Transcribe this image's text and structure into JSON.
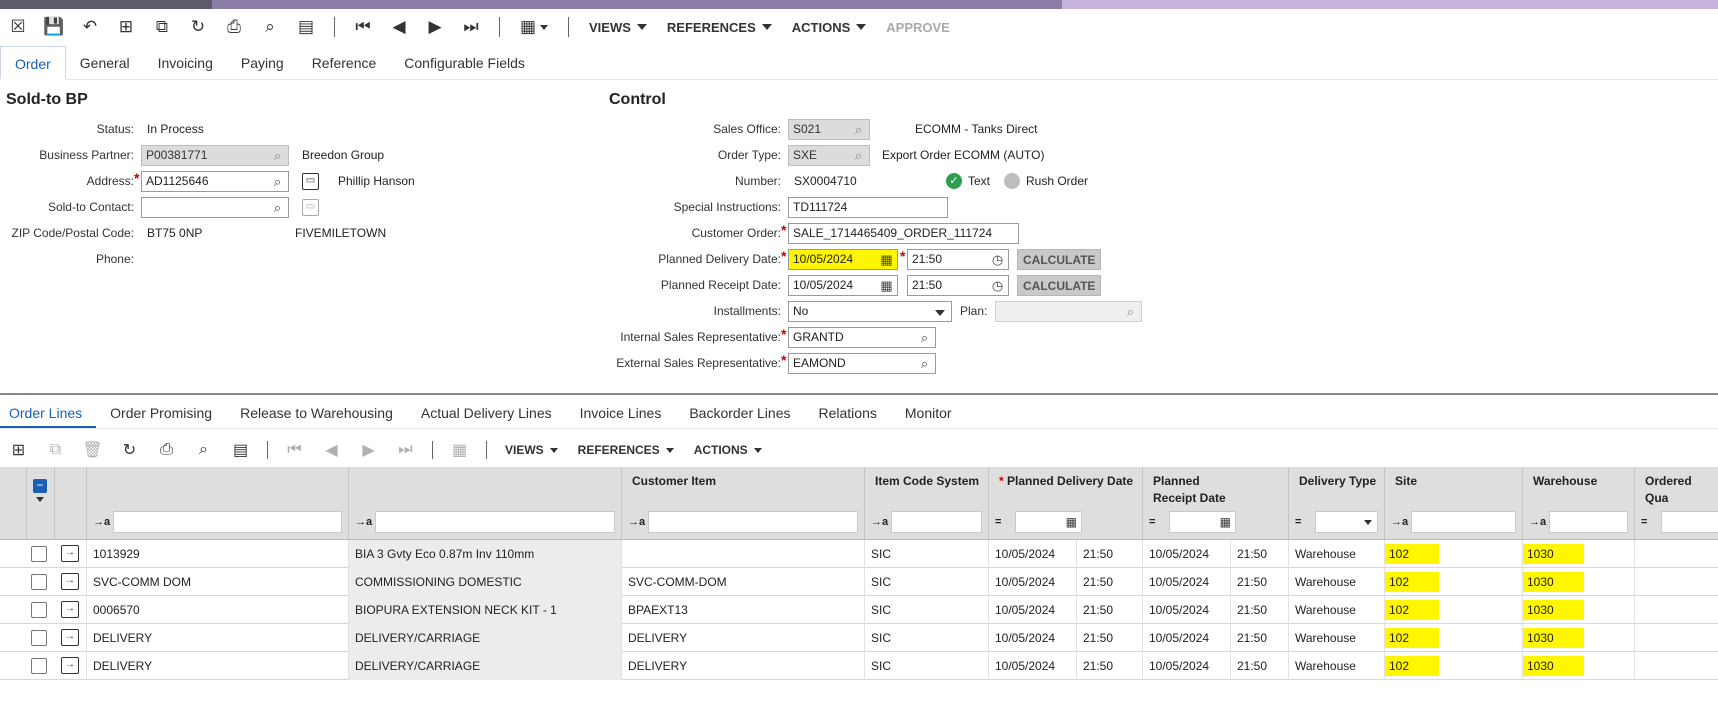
{
  "toolbar": {
    "menus": [
      "VIEWS",
      "REFERENCES",
      "ACTIONS"
    ],
    "approve_label": "APPROVE"
  },
  "tabs": [
    "Order",
    "General",
    "Invoicing",
    "Paying",
    "Reference",
    "Configurable Fields"
  ],
  "sold_to": {
    "title": "Sold-to BP",
    "status_label": "Status:",
    "status_value": "In Process",
    "bp_label": "Business Partner:",
    "bp_value": "P00381771",
    "bp_name": "Breedon Group",
    "address_label": "Address:",
    "address_value": "AD1125646",
    "address_name": "Phillip Hanson",
    "contact_label": "Sold-to Contact:",
    "contact_value": "",
    "zip_label": "ZIP Code/Postal Code:",
    "zip_value": "BT75 0NP",
    "city_value": "FIVEMILETOWN",
    "phone_label": "Phone:"
  },
  "control": {
    "title": "Control",
    "sales_office_label": "Sales Office:",
    "sales_office_value": "S021",
    "sales_office_name": "ECOMM - Tanks Direct",
    "order_type_label": "Order Type:",
    "order_type_value": "SXE",
    "order_type_name": "Export Order ECOMM (AUTO)",
    "number_label": "Number:",
    "number_value": "SX0004710",
    "text_label": "Text",
    "rush_label": "Rush Order",
    "special_label": "Special Instructions:",
    "special_value": "TD111724",
    "customer_order_label": "Customer Order:",
    "customer_order_value": "SALE_1714465409_ORDER_111724",
    "planned_delivery_label": "Planned Delivery Date:",
    "planned_delivery_date": "10/05/2024",
    "planned_delivery_time": "21:50",
    "planned_receipt_label": "Planned Receipt Date:",
    "planned_receipt_date": "10/05/2024",
    "planned_receipt_time": "21:50",
    "calculate_label": "CALCULATE",
    "installments_label": "Installments:",
    "installments_value": "No",
    "plan_label": "Plan:",
    "internal_rep_label": "Internal Sales Representative:",
    "internal_rep_value": "GRANTD",
    "external_rep_label": "External Sales Representative:",
    "external_rep_value": "EAMOND"
  },
  "lower_tabs": [
    "Order Lines",
    "Order Promising",
    "Release to Warehousing",
    "Actual Delivery Lines",
    "Invoice Lines",
    "Backorder Lines",
    "Relations",
    "Monitor"
  ],
  "grid": {
    "headers": {
      "customer_item": "Customer Item",
      "item_code_system": "Item Code System",
      "planned_delivery_date": "Planned Delivery Date",
      "planned_receipt_date_1": "Planned",
      "planned_receipt_date_2": "Receipt Date",
      "delivery_type": "Delivery Type",
      "site": "Site",
      "warehouse": "Warehouse",
      "ordered_qty": "Ordered Qua"
    },
    "filter_text_icon": "→a",
    "filter_eq_icon": "=",
    "rows": [
      {
        "item": "1013929",
        "desc": "BIA 3 Gvty Eco 0.87m Inv 110mm",
        "cust_item": "",
        "ics": "SIC",
        "pdd": "10/05/2024",
        "pdt": "21:50",
        "prd": "10/05/2024",
        "prt": "21:50",
        "dtype": "Warehouse",
        "site": "102",
        "wh": "1030"
      },
      {
        "item": "SVC-COMM DOM",
        "desc": "COMMISSIONING DOMESTIC",
        "cust_item": "SVC-COMM-DOM",
        "ics": "SIC",
        "pdd": "10/05/2024",
        "pdt": "21:50",
        "prd": "10/05/2024",
        "prt": "21:50",
        "dtype": "Warehouse",
        "site": "102",
        "wh": "1030"
      },
      {
        "item": "0006570",
        "desc": "BIOPURA EXTENSION NECK KIT - 1",
        "cust_item": "BPAEXT13",
        "ics": "SIC",
        "pdd": "10/05/2024",
        "pdt": "21:50",
        "prd": "10/05/2024",
        "prt": "21:50",
        "dtype": "Warehouse",
        "site": "102",
        "wh": "1030"
      },
      {
        "item": "DELIVERY",
        "desc": "DELIVERY/CARRIAGE",
        "cust_item": "DELIVERY",
        "ics": "SIC",
        "pdd": "10/05/2024",
        "pdt": "21:50",
        "prd": "10/05/2024",
        "prt": "21:50",
        "dtype": "Warehouse",
        "site": "102",
        "wh": "1030"
      },
      {
        "item": "DELIVERY",
        "desc": "DELIVERY/CARRIAGE",
        "cust_item": "DELIVERY",
        "ics": "SIC",
        "pdd": "10/05/2024",
        "pdt": "21:50",
        "prd": "10/05/2024",
        "prt": "21:50",
        "dtype": "Warehouse",
        "site": "102",
        "wh": "1030"
      }
    ]
  },
  "colors": {
    "accent": "#1a5fb4",
    "highlight": "#fff600",
    "required": "#cc0000",
    "text_on": "#2e9e4f"
  }
}
